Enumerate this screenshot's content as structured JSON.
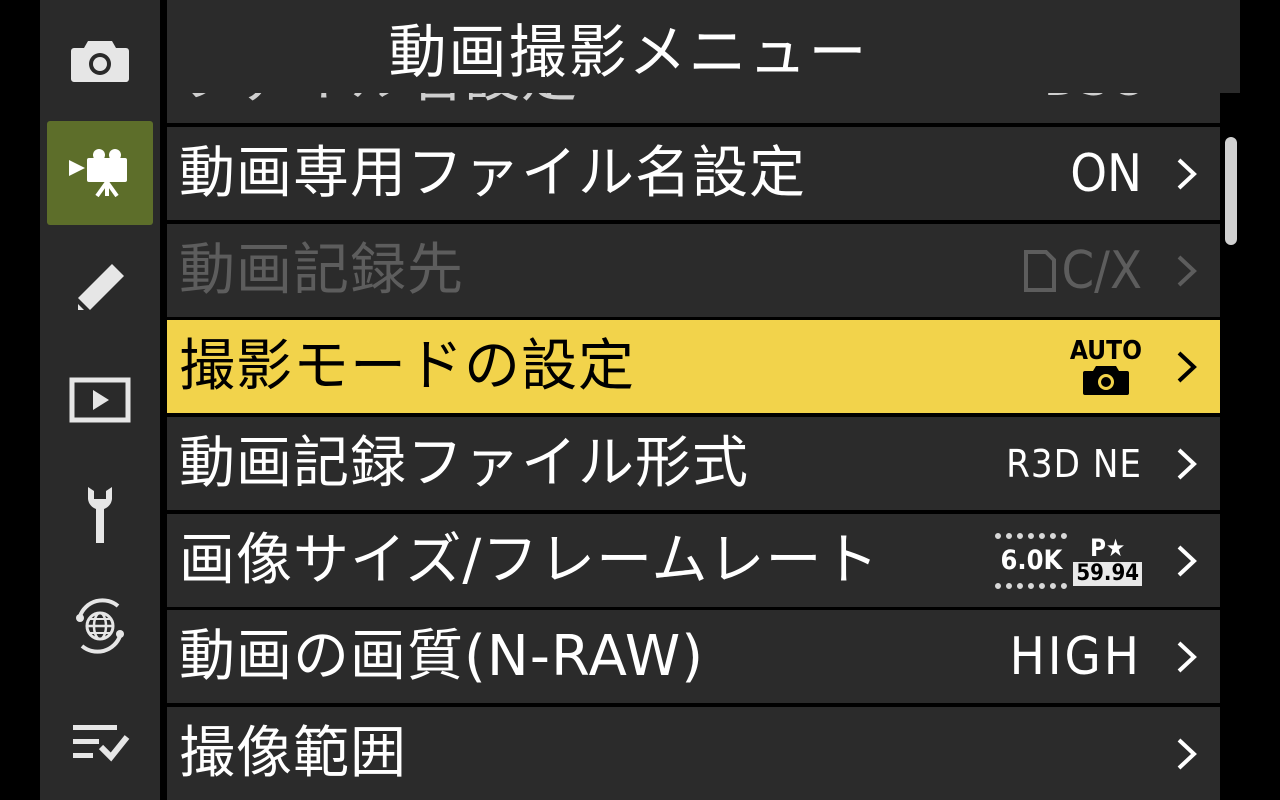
{
  "header": {
    "title": "動画撮影メニュー"
  },
  "sidebar": {
    "items": [
      {
        "icon": "camera-icon",
        "active": false
      },
      {
        "icon": "movie-camera-icon",
        "active": true
      },
      {
        "icon": "pencil-icon",
        "active": false
      },
      {
        "icon": "playback-icon",
        "active": false
      },
      {
        "icon": "wrench-icon",
        "active": false
      },
      {
        "icon": "network-icon",
        "active": false
      },
      {
        "icon": "my-menu-icon",
        "active": false
      }
    ]
  },
  "menu": {
    "rows": [
      {
        "label": "ファイル名設定",
        "value": "DSC",
        "state": "partial"
      },
      {
        "label": "動画専用ファイル名設定",
        "value": "ON",
        "state": "normal"
      },
      {
        "label": "動画記録先",
        "value": "C/X",
        "state": "disabled"
      },
      {
        "label": "撮影モードの設定",
        "value": "AUTO",
        "state": "selected"
      },
      {
        "label": "動画記録ファイル形式",
        "value": "R3D NE",
        "state": "normal"
      },
      {
        "label": "画像サイズ/フレームレート",
        "value_size": "6.0K",
        "value_mark": "P★",
        "value_fps": "59.94",
        "state": "normal"
      },
      {
        "label": "動画の画質(N-RAW)",
        "value": "HIGH",
        "state": "normal"
      },
      {
        "label": "撮像範囲",
        "value": "",
        "state": "normal"
      }
    ]
  },
  "colors": {
    "highlight": "#f2d34b",
    "active_tab": "#5d6e2a",
    "row_bg": "#2b2b2b",
    "disabled_text": "#5d5d5d"
  }
}
